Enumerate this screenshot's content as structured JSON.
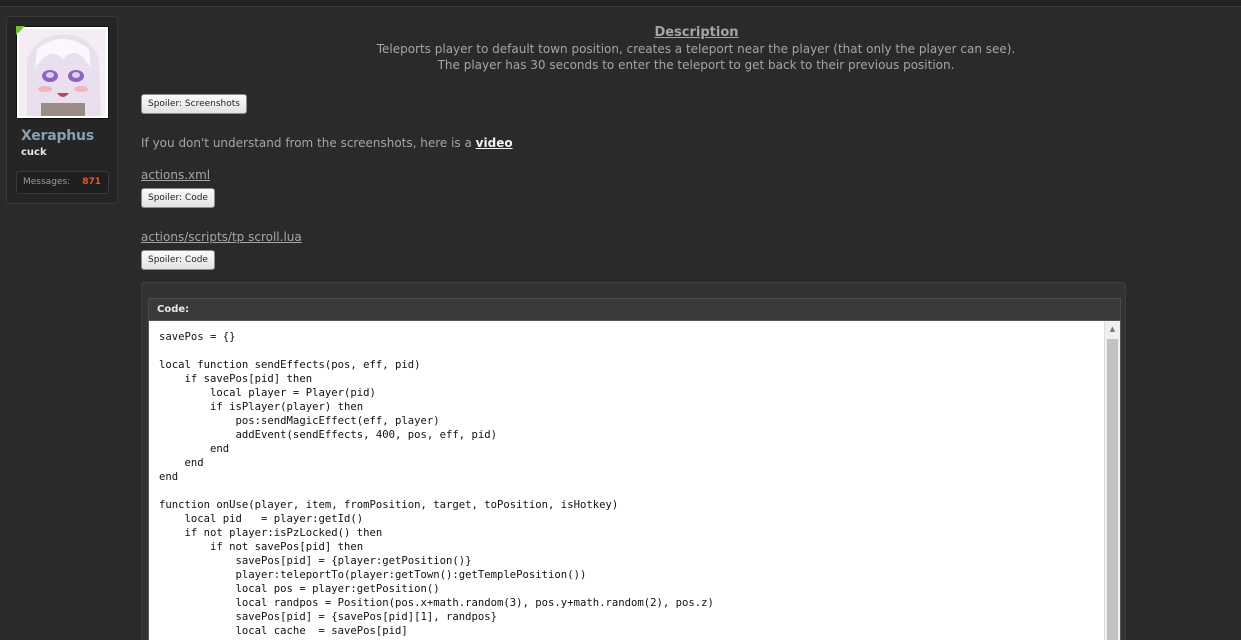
{
  "user": {
    "name": "Xeraphus",
    "title": "cuck",
    "messages_label": "Messages:",
    "messages_value": "871",
    "online_color": "#6fbf3a"
  },
  "description": {
    "title": "Description",
    "line1": "Teleports player to default town position, creates a teleport near the player (that only the player can see).",
    "line2": "The player has 30 seconds to enter the teleport to get back to their previous position."
  },
  "spoiler_screenshots": "Spoiler: Screenshots",
  "video_paragraph": {
    "text": "If you don't understand from the screenshots, here is a ",
    "link": "video"
  },
  "files": [
    {
      "name": "actions.xml",
      "spoiler": "Spoiler: Code"
    },
    {
      "name": "actions/scripts/tp scroll.lua",
      "spoiler": "Spoiler: Code"
    }
  ],
  "code_block": {
    "header": "Code:",
    "lines": [
      "savePos = {}",
      "",
      "local function sendEffects(pos, eff, pid)",
      "    if savePos[pid] then",
      "        local player = Player(pid)",
      "        if isPlayer(player) then",
      "            pos:sendMagicEffect(eff, player)",
      "            addEvent(sendEffects, 400, pos, eff, pid)",
      "        end",
      "    end",
      "end",
      "",
      "function onUse(player, item, fromPosition, target, toPosition, isHotkey)",
      "    local pid   = player:getId()",
      "    if not player:isPzLocked() then",
      "        if not savePos[pid] then",
      "            savePos[pid] = {player:getPosition()}",
      "            player:teleportTo(player:getTown():getTemplePosition())",
      "            local pos = player:getPosition()",
      "            local randpos = Position(pos.x+math.random(3), pos.y+math.random(2), pos.z)",
      "            savePos[pid] = {savePos[pid][1], randpos}",
      "            local cache  = savePos[pid]"
    ]
  }
}
